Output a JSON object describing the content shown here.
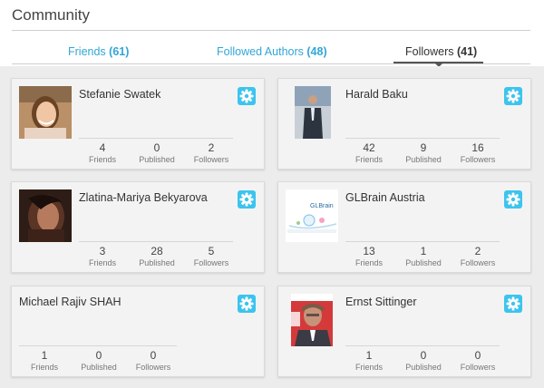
{
  "page": {
    "title": "Community"
  },
  "tabs": [
    {
      "label": "Friends",
      "count": "(61)",
      "active": false
    },
    {
      "label": "Followed Authors",
      "count": "(48)",
      "active": false
    },
    {
      "label": "Followers",
      "count": "(41)",
      "active": true
    }
  ],
  "stat_labels": {
    "friends": "Friends",
    "published": "Published",
    "followers": "Followers"
  },
  "colors": {
    "accent": "#31a6d6",
    "gear": "#3cc4ee"
  },
  "cards": [
    {
      "name": "Stefanie Swatek",
      "avatar": "photo-woman",
      "friends": "4",
      "published": "0",
      "followers": "2"
    },
    {
      "name": "Harald Baku",
      "avatar": "photo-man-suit",
      "friends": "42",
      "published": "9",
      "followers": "16"
    },
    {
      "name": "Zlatina-Mariya Bekyarova",
      "avatar": "photo-woman-dark",
      "friends": "3",
      "published": "28",
      "followers": "5"
    },
    {
      "name": "GLBrain Austria",
      "avatar": "logo-glbrain",
      "avatar_text": "GLBrain",
      "friends": "13",
      "published": "1",
      "followers": "2"
    },
    {
      "name": "Michael Rajiv SHAH",
      "avatar": null,
      "friends": "1",
      "published": "0",
      "followers": "0"
    },
    {
      "name": "Ernst Sittinger",
      "avatar": "photo-man-glasses",
      "friends": "1",
      "published": "0",
      "followers": "0"
    }
  ]
}
